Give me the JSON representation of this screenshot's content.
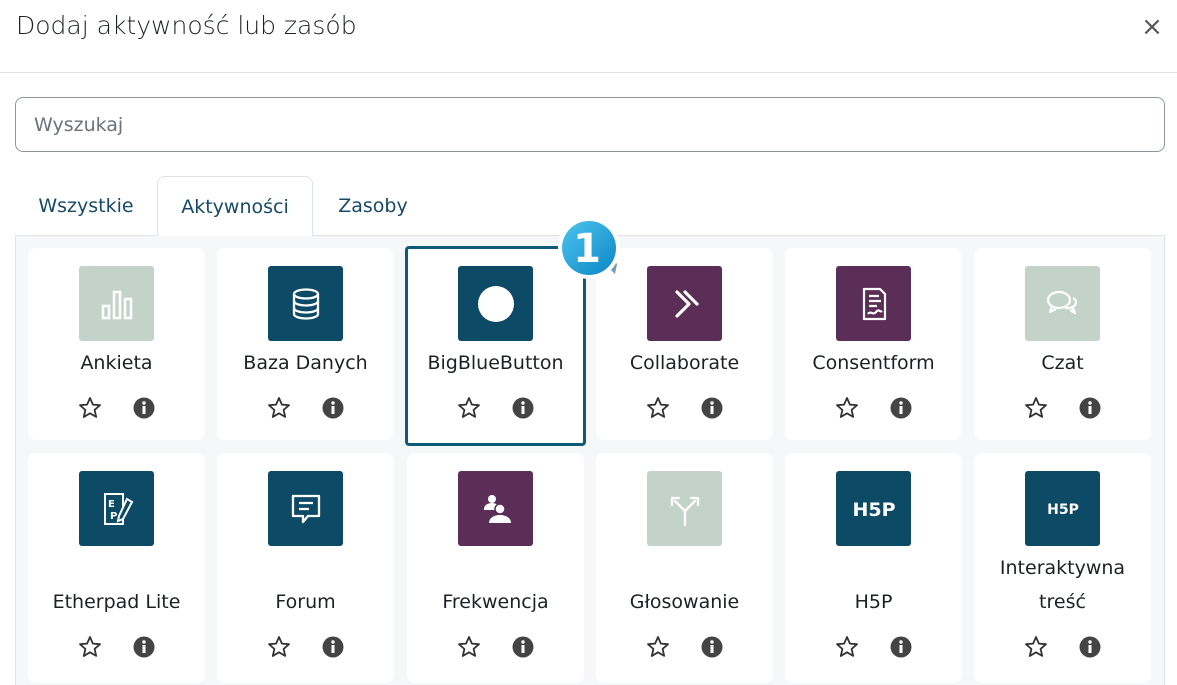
{
  "modal": {
    "title": "Dodaj aktywność lub zasób",
    "close_label": "×"
  },
  "search": {
    "placeholder": "Wyszukaj"
  },
  "tabs": [
    {
      "label": "Wszystkie",
      "active": false
    },
    {
      "label": "Aktywności",
      "active": true
    },
    {
      "label": "Zasoby",
      "active": false
    }
  ],
  "step_badge": "1",
  "cards": [
    {
      "name": "Ankieta",
      "icon": "bar-chart-icon",
      "color": "#c4d3c9"
    },
    {
      "name": "Baza Danych",
      "icon": "database-icon",
      "color": "#0d4a66"
    },
    {
      "name": "BigBlueButton",
      "icon": "circle-icon",
      "color": "#0d4a66"
    },
    {
      "name": "Collaborate",
      "icon": "chevron-right-icon",
      "color": "#5a2e56"
    },
    {
      "name": "Consentform",
      "icon": "signed-document-icon",
      "color": "#5a2e56"
    },
    {
      "name": "Czat",
      "icon": "chat-bubbles-icon",
      "color": "#c4d3c9"
    },
    {
      "name": "Etherpad Lite",
      "icon": "etherpad-icon",
      "color": "#0d4a66"
    },
    {
      "name": "Forum",
      "icon": "message-icon",
      "color": "#0d4a66"
    },
    {
      "name": "Frekwencja",
      "icon": "attendance-icon",
      "color": "#5a2e56"
    },
    {
      "name": "Głosowanie",
      "icon": "split-arrows-icon",
      "color": "#c4d3c9"
    },
    {
      "name": "H5P",
      "icon": "h5p-icon",
      "color": "#0d4a66"
    },
    {
      "name_line1": "Interaktywna",
      "name_line2": "treść",
      "icon": "h5p-small-icon",
      "color": "#0d4a66"
    }
  ],
  "logo_text": {
    "h5p": "H5P",
    "ep_e": "E",
    "ep_p": "P"
  }
}
